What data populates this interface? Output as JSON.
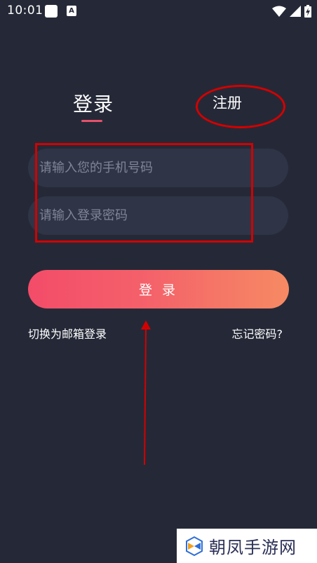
{
  "status_bar": {
    "time": "10:01",
    "icons": [
      "notification-square-icon",
      "font-a-icon",
      "wifi-icon",
      "signal-icon",
      "battery-charging-icon"
    ],
    "a_label": "A"
  },
  "tabs": {
    "login_label": "登录",
    "register_label": "注册",
    "active_tab": "login",
    "accent_color": "#e8506a"
  },
  "form": {
    "phone_placeholder": "请输入您的手机号码",
    "phone_value": "",
    "password_placeholder": "请输入登录密码",
    "password_value": "",
    "login_button_label": "登 录",
    "button_gradient": [
      "#f34c69",
      "#f68a63"
    ]
  },
  "links": {
    "switch_email": "切换为邮箱登录",
    "forgot_password": "忘记密码?"
  },
  "annotations": {
    "color": "#d40000"
  },
  "watermark": {
    "text": "朝凤手游网"
  },
  "colors": {
    "background": "#252937",
    "input_background": "#2f3446",
    "placeholder": "#7f8497"
  }
}
